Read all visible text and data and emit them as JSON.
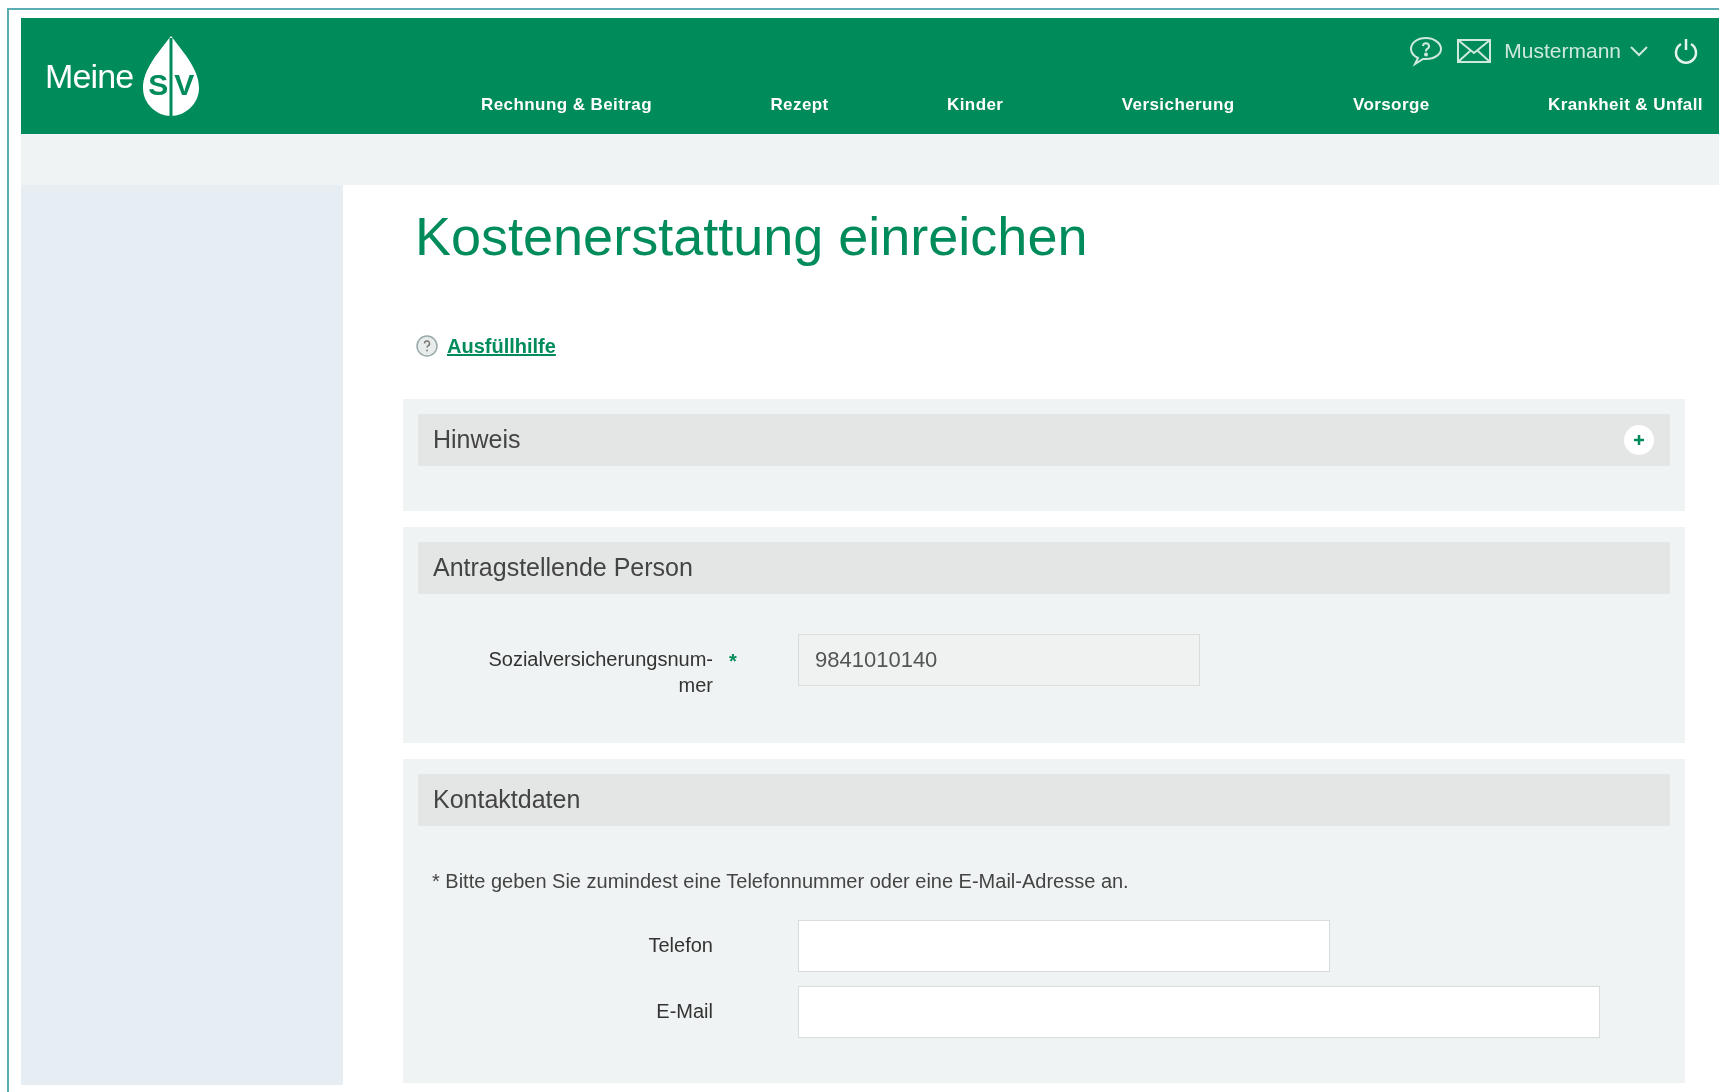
{
  "header": {
    "logo": {
      "word": "Meine",
      "letters": [
        "S",
        "V"
      ]
    },
    "user": {
      "name": "Mustermann"
    },
    "nav": [
      {
        "label": "Rechnung & Beitrag"
      },
      {
        "label": "Rezept"
      },
      {
        "label": "Kinder"
      },
      {
        "label": "Versicherung"
      },
      {
        "label": "Vorsorge"
      },
      {
        "label": "Krankheit & Unfall"
      }
    ]
  },
  "page": {
    "title": "Kostenerstattung einreichen",
    "help_link": "Ausfüllhilfe"
  },
  "sections": [
    {
      "title": "Hinweis",
      "expanded": false
    },
    {
      "title": "Antragstellende Person",
      "expanded": true,
      "fields": [
        {
          "label": "Sozialversicherungsnum-mer",
          "required_mark": "*",
          "value": "9841010140",
          "disabled": true
        }
      ]
    },
    {
      "title": "Kontaktdaten",
      "expanded": true,
      "note": "* Bitte geben Sie zumindest eine Telefonnummer oder eine E-Mail-Adresse an.",
      "fields": [
        {
          "label": "Telefon",
          "disabled": false
        },
        {
          "label": "E-Mail",
          "disabled": false
        }
      ]
    }
  ]
}
